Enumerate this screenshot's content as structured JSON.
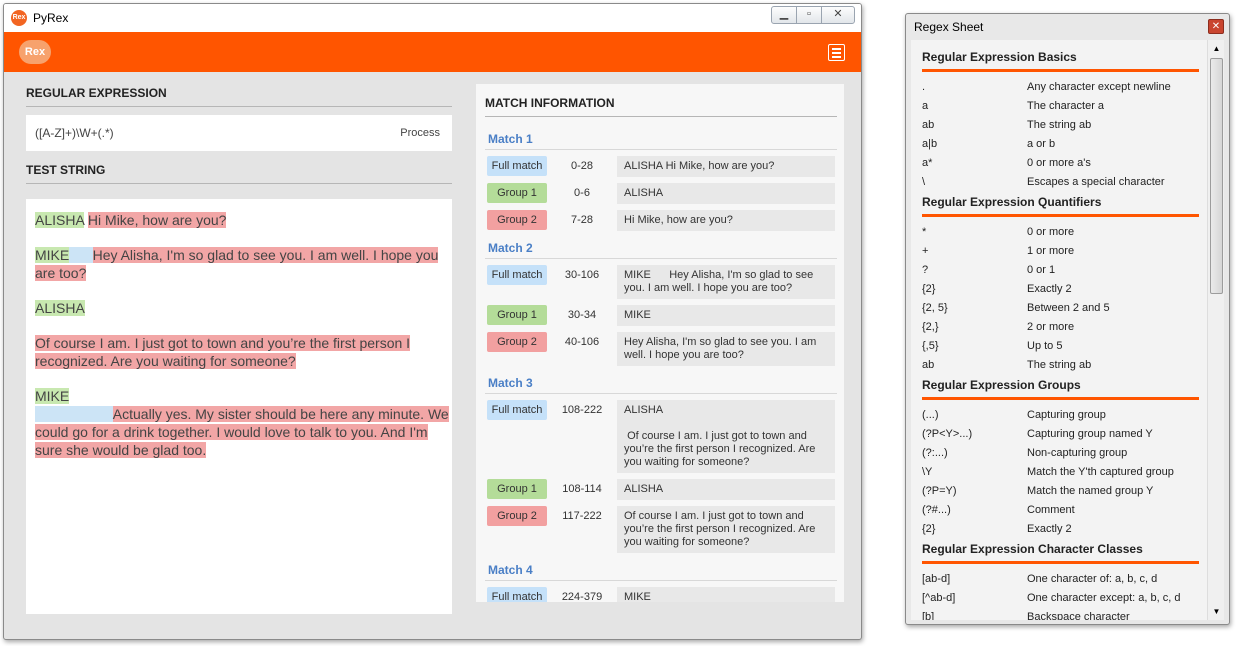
{
  "app": {
    "title": "PyRex",
    "logo_text": "Rex"
  },
  "titlebar": {
    "minimize_icon": "minimize-icon",
    "maximize_icon": "maximize-icon",
    "close_icon": "close-icon"
  },
  "regex": {
    "header": "REGULAR EXPRESSION",
    "value": "([A-Z]+)\\W+(.*)",
    "process_label": "Process"
  },
  "test": {
    "header": "TEST STRING",
    "lines": [
      {
        "name": "ALISHA",
        "text": "Hi Mike, how are you?"
      },
      {
        "name": "MIKE",
        "text": "Hey Alisha, I'm so glad to see you. I am well. I hope you are too?"
      },
      {
        "name": "ALISHA",
        "text": "Of course I am. I just got to town and you’re the first person I recognized. Are you waiting for someone?"
      },
      {
        "name": "MIKE",
        "text": "Actually yes. My sister should be here any minute. We could go for a drink together. I would love to talk to you. And I'm sure she would be glad too."
      }
    ]
  },
  "matches": {
    "header": "MATCH INFORMATION",
    "items": [
      {
        "title": "Match 1",
        "rows": [
          {
            "label": "Full match",
            "range": "0-28",
            "value": "ALISHA Hi Mike, how are you?"
          },
          {
            "label": "Group 1",
            "range": "0-6",
            "value": "ALISHA"
          },
          {
            "label": "Group 2",
            "range": "7-28",
            "value": "Hi Mike, how are you?"
          }
        ]
      },
      {
        "title": "Match 2",
        "rows": [
          {
            "label": "Full match",
            "range": "30-106",
            "value": "MIKE      Hey Alisha, I'm so glad to see you. I am well. I hope you are too?"
          },
          {
            "label": "Group 1",
            "range": "30-34",
            "value": "MIKE"
          },
          {
            "label": "Group 2",
            "range": "40-106",
            "value": "Hey Alisha, I'm so glad to see you. I am well. I hope you are too?"
          }
        ]
      },
      {
        "title": "Match 3",
        "rows": [
          {
            "label": "Full match",
            "range": "108-222",
            "value": "ALISHA\n\n Of course I am. I just got to town and you’re the first person I recognized. Are you waiting for someone?"
          },
          {
            "label": "Group 1",
            "range": "108-114",
            "value": "ALISHA"
          },
          {
            "label": "Group 2",
            "range": "117-222",
            "value": "Of course I am. I just got to town and you’re the first person I recognized. Are you waiting for someone?"
          }
        ]
      },
      {
        "title": "Match 4",
        "rows": [
          {
            "label": "Full match",
            "range": "224-379",
            "value": "MIKE\n                    Actually yes. My sister should be here any minute. We could go for a drink together. I would love to talk to you. And"
          }
        ]
      }
    ]
  },
  "sheet": {
    "title": "Regex Sheet",
    "categories": [
      {
        "title": "Regular Expression Basics",
        "rows": [
          {
            "expr": ".",
            "desc": "Any character except newline"
          },
          {
            "expr": "a",
            "desc": "The character a"
          },
          {
            "expr": "ab",
            "desc": "The string ab"
          },
          {
            "expr": "a|b",
            "desc": "a or b"
          },
          {
            "expr": "a*",
            "desc": "0 or more a's"
          },
          {
            "expr": "\\",
            "desc": "Escapes a special character"
          }
        ]
      },
      {
        "title": "Regular Expression Quantifiers",
        "rows": [
          {
            "expr": "*",
            "desc": "0 or more"
          },
          {
            "expr": "+",
            "desc": "1 or more"
          },
          {
            "expr": "?",
            "desc": "0 or 1"
          },
          {
            "expr": "{2}",
            "desc": "Exactly 2"
          },
          {
            "expr": "{2, 5}",
            "desc": "Between 2 and 5"
          },
          {
            "expr": "{2,}",
            "desc": "2 or more"
          },
          {
            "expr": "{,5}",
            "desc": "Up to 5"
          },
          {
            "expr": "ab",
            "desc": "The string ab"
          }
        ]
      },
      {
        "title": "Regular Expression Groups",
        "rows": [
          {
            "expr": "(...)",
            "desc": "Capturing group"
          },
          {
            "expr": "(?P<Y>...)",
            "desc": "Capturing group named Y"
          },
          {
            "expr": "(?:...)",
            "desc": "Non-capturing group"
          },
          {
            "expr": "\\Y",
            "desc": "Match the Y'th captured group"
          },
          {
            "expr": "(?P=Y)",
            "desc": "Match the named group Y"
          },
          {
            "expr": "(?#...)",
            "desc": "Comment"
          },
          {
            "expr": "{2}",
            "desc": "Exactly 2"
          }
        ]
      },
      {
        "title": "Regular Expression Character Classes",
        "rows": [
          {
            "expr": "[ab-d]",
            "desc": "One character of: a, b, c, d"
          },
          {
            "expr": "[^ab-d]",
            "desc": "One character except: a, b, c, d"
          },
          {
            "expr": "[b]",
            "desc": "Backspace character"
          }
        ]
      }
    ]
  },
  "colors": {
    "accent": "#ff5500",
    "full_match": "#c5e1f9",
    "group1": "#b4dc99",
    "group2": "#f2a0a0",
    "match_title": "#4a7fc6"
  }
}
